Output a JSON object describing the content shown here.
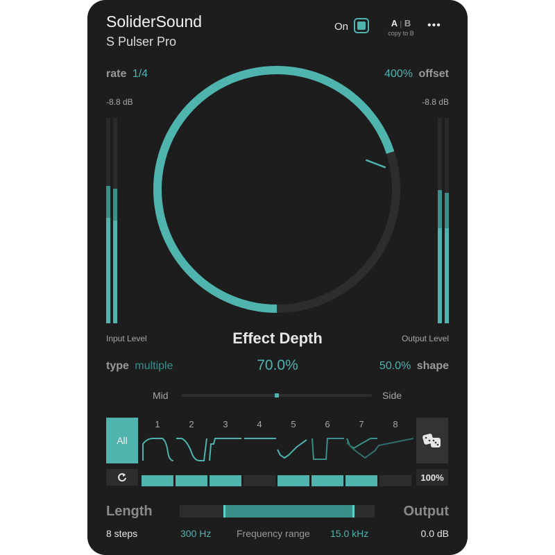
{
  "header": {
    "brand": "SoliderSound",
    "product": "S Pulser Pro",
    "power_label": "On",
    "ab_a": "A",
    "ab_sep": "|",
    "ab_b": "B",
    "copy_label": "copy to B",
    "menu_glyph": "•••"
  },
  "rate": {
    "label": "rate",
    "value": "1/4"
  },
  "offset": {
    "label": "offset",
    "value": "400%"
  },
  "meters": {
    "input_db": "-8.8 dB",
    "output_db": "-8.8 dB",
    "input_label": "Input Level",
    "output_label": "Output Level",
    "input_level_fraction": 0.67,
    "output_level_fraction": 0.65
  },
  "depth": {
    "label": "Effect Depth",
    "value": "70.0%",
    "fraction": 0.7
  },
  "type": {
    "label": "type",
    "value": "multiple"
  },
  "shape": {
    "label": "shape",
    "value": "50.0%"
  },
  "midside": {
    "left_label": "Mid",
    "right_label": "Side",
    "position_fraction": 0.5
  },
  "steps": {
    "all_label": "All",
    "numbers": [
      "1",
      "2",
      "3",
      "4",
      "5",
      "6",
      "7",
      "8"
    ],
    "enabled": [
      true,
      true,
      true,
      false,
      true,
      true,
      true,
      false
    ],
    "reset_icon": "reload-icon",
    "dice_icon": "dice-icon",
    "amount": "100%"
  },
  "footer": {
    "length_label": "Length",
    "length_value": "8 steps",
    "freq_low": "300 Hz",
    "freq_label": "Frequency range",
    "freq_high": "15.0 kHz",
    "output_label": "Output",
    "output_value": "0.0 dB"
  },
  "colors": {
    "accent": "#4fb3ae",
    "panel": "#1d1d1d",
    "track": "#2d2d2d"
  }
}
